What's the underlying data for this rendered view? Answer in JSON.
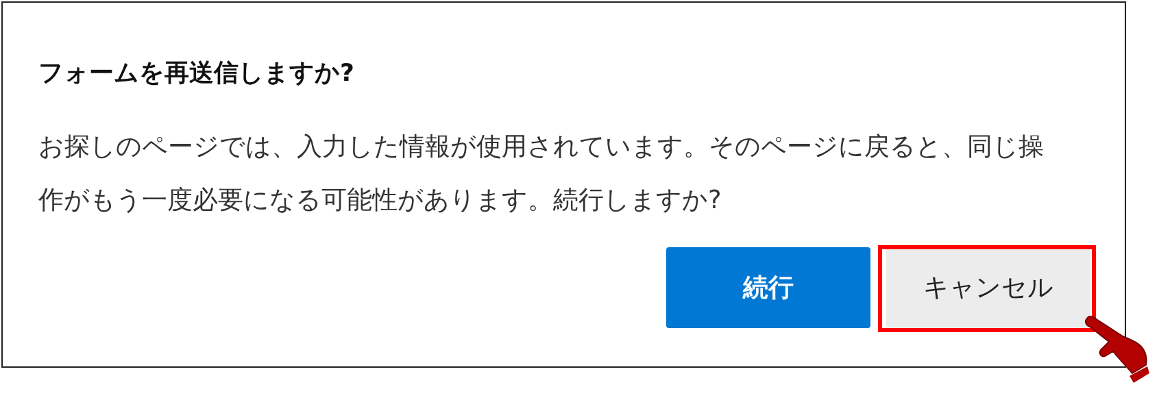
{
  "dialog": {
    "title": "フォームを再送信しますか?",
    "message": "お探しのページでは、入力した情報が使用されています。そのページに戻ると、同じ操作がもう一度必要になる可能性があります。続行しますか?",
    "buttons": [
      {
        "label": "続行",
        "kind": "primary",
        "highlighted": false
      },
      {
        "label": "キャンセル",
        "kind": "secondary",
        "highlighted": true
      }
    ]
  }
}
